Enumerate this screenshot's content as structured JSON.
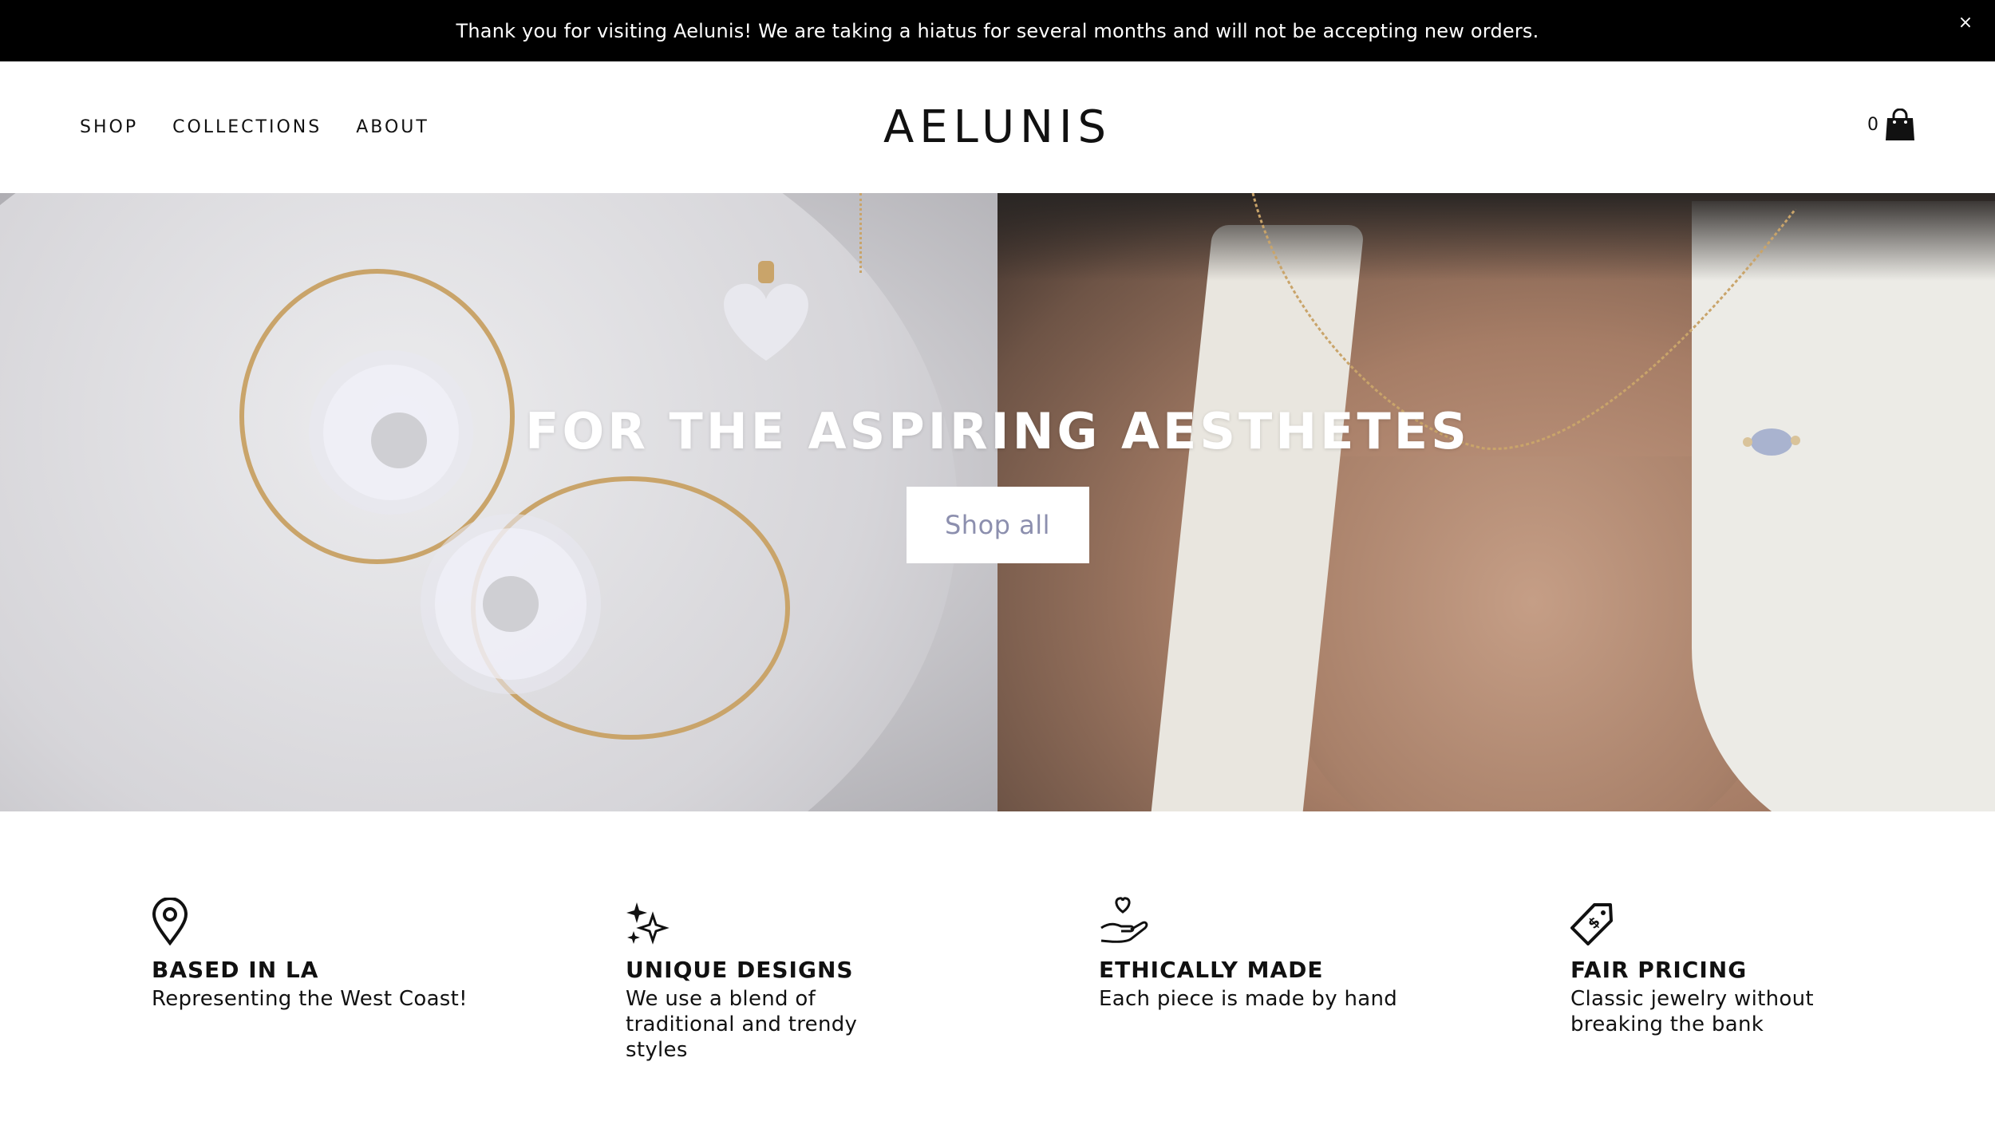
{
  "announcement": {
    "text": "Thank you for visiting Aelunis! We are taking a hiatus for several months and will not be accepting new orders.",
    "close_glyph": "×"
  },
  "header": {
    "nav": [
      "SHOP",
      "COLLECTIONS",
      "ABOUT"
    ],
    "logo": "AELUNIS",
    "cart_count": "0",
    "cart_icon": "shopping-bag-icon"
  },
  "hero": {
    "title": "FOR THE ASPIRING AESTHETES",
    "button_label": "Shop all"
  },
  "features": [
    {
      "icon": "map-pin-icon",
      "title": "BASED IN LA",
      "desc": "Representing the West Coast!"
    },
    {
      "icon": "sparkles-icon",
      "title": "UNIQUE DESIGNS",
      "desc": "We use a blend of traditional and trendy styles"
    },
    {
      "icon": "heart-hand-icon",
      "title": "ETHICALLY MADE",
      "desc": "Each piece is made by hand"
    },
    {
      "icon": "price-tag-icon",
      "title": "FAIR PRICING",
      "desc": "Classic jewelry without breaking the bank"
    }
  ],
  "colors": {
    "announcement_bg": "#000000",
    "button_text": "#8c8fae",
    "text": "#111111"
  }
}
